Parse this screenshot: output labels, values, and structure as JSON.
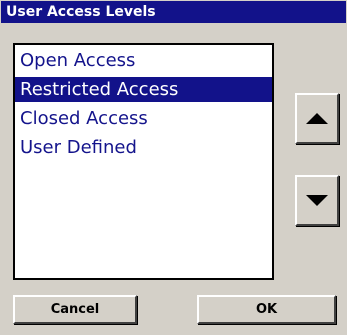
{
  "window": {
    "title": "User Access Levels"
  },
  "list": {
    "items": [
      {
        "label": "Open Access",
        "selected": false
      },
      {
        "label": "Restricted Access",
        "selected": true
      },
      {
        "label": "Closed Access",
        "selected": false
      },
      {
        "label": "User Defined",
        "selected": false
      }
    ]
  },
  "buttons": {
    "up_icon": "arrow-up-icon",
    "down_icon": "arrow-down-icon",
    "cancel_label": "Cancel",
    "ok_label": "OK"
  },
  "colors": {
    "title_bar": "#12128a",
    "selection": "#12128a",
    "item_text": "#14148c",
    "background": "#d4d0c8"
  }
}
